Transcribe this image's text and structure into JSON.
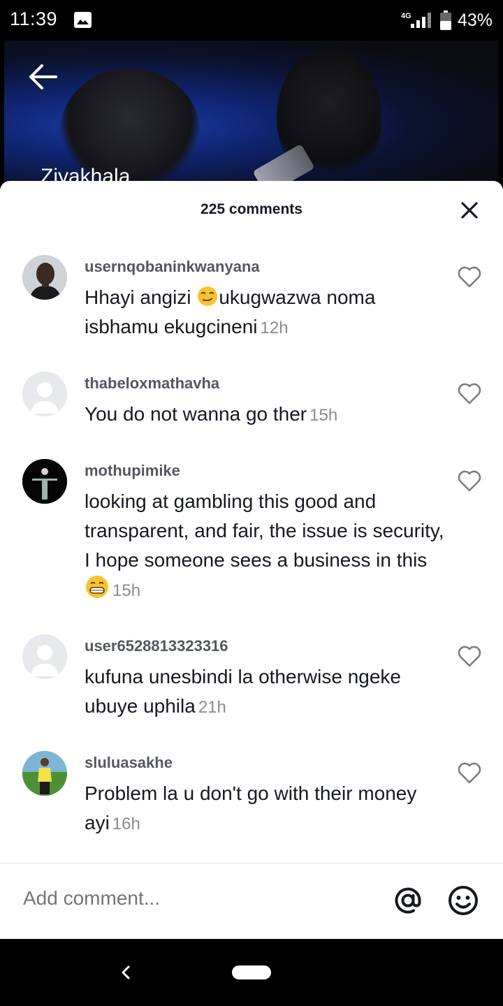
{
  "status_bar": {
    "time": "11:39",
    "network": "4G",
    "battery": "43%"
  },
  "video": {
    "caption": "Ziyakhala"
  },
  "comments_sheet": {
    "title": "225 comments",
    "comments": [
      {
        "username": "usernqobaninkwanyana",
        "text_before": "Hhayi angizi ",
        "emoji": "smirk-emoji",
        "text_after": "ukugwazwa noma isbhamu ekugcineni",
        "time": "12h"
      },
      {
        "username": "thabeloxmathavha",
        "text_before": "You do not wanna go ther",
        "time": "15h"
      },
      {
        "username": "mothupimike",
        "text_before": "looking at gambling this good and transparent, and fair, the issue is security, I hope someone sees a business in this",
        "emoji": "grin-emoji",
        "time": "15h"
      },
      {
        "username": "user6528813323316",
        "text_before": "kufuna unesbindi la otherwise ngeke ubuye uphila",
        "time": "21h"
      },
      {
        "username": "sluluasakhe",
        "text_before": "Problem la u don't go with their money ayi",
        "time": "16h"
      }
    ]
  },
  "comment_bar": {
    "placeholder": "Add comment..."
  },
  "colors": {
    "text_primary": "#161823",
    "username": "#55585f",
    "timestamp": "#8a8b91",
    "placeholder": "#a7a8ad"
  }
}
